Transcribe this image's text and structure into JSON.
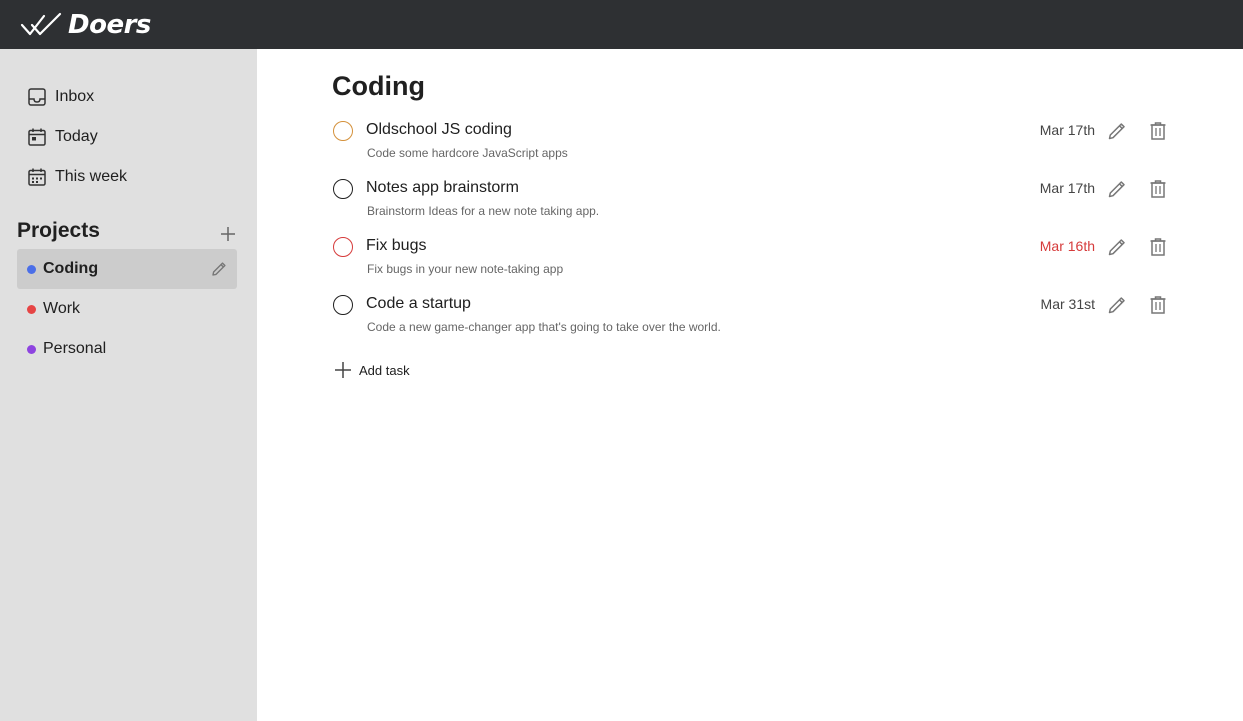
{
  "app": {
    "name": "Doers"
  },
  "sidebar": {
    "nav": [
      {
        "label": "Inbox",
        "icon": "inbox-icon"
      },
      {
        "label": "Today",
        "icon": "calendar-today-icon"
      },
      {
        "label": "This week",
        "icon": "calendar-week-icon"
      }
    ],
    "projects_title": "Projects",
    "projects": [
      {
        "label": "Coding",
        "color": "#4b6fe8",
        "active": true
      },
      {
        "label": "Work",
        "color": "#e64545"
      },
      {
        "label": "Personal",
        "color": "#8e44e0"
      }
    ]
  },
  "main": {
    "title": "Coding",
    "tasks": [
      {
        "title": "Oldschool JS coding",
        "description": "Code some hardcore JavaScript apps",
        "date": "Mar 17th",
        "check_color": "#d4913b",
        "date_color": "#444444"
      },
      {
        "title": "Notes app brainstorm",
        "description": "Brainstorm Ideas for a new note taking app.",
        "date": "Mar 17th",
        "check_color": "#202020",
        "date_color": "#444444"
      },
      {
        "title": "Fix bugs",
        "description": "Fix bugs in your new note-taking app",
        "date": "Mar 16th",
        "check_color": "#d63b3b",
        "date_color": "#d63b3b"
      },
      {
        "title": "Code a startup",
        "description": "Code a new game-changer app that's going to take over the world.",
        "date": "Mar 31st",
        "check_color": "#202020",
        "date_color": "#444444"
      }
    ],
    "add_task_label": "Add task"
  }
}
